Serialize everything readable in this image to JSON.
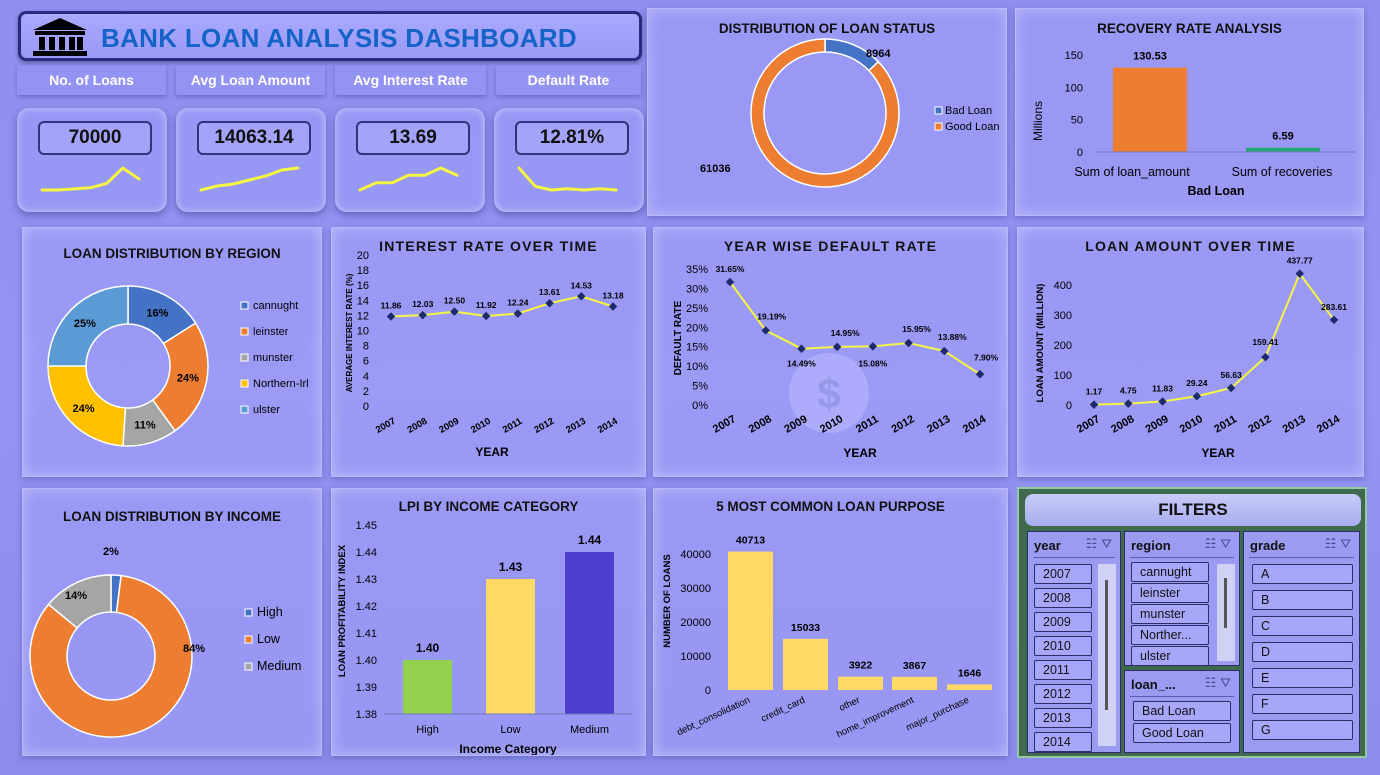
{
  "header": {
    "title": "BANK LOAN ANALYSIS DASHBOARD",
    "icon": "bank-icon"
  },
  "kpis": [
    {
      "label": "No. of Loans",
      "value": "70000",
      "trend": [
        10,
        10,
        11,
        12,
        16,
        30,
        20
      ]
    },
    {
      "label": "Avg Loan Amount",
      "value": "14063.14",
      "trend": [
        10,
        12,
        13,
        15,
        17,
        20,
        21
      ]
    },
    {
      "label": "Avg Interest Rate",
      "value": "13.69",
      "trend": [
        14,
        15,
        15,
        16,
        16,
        17,
        16
      ]
    },
    {
      "label": "Default Rate",
      "value": "12.81%",
      "trend": [
        30,
        15,
        12,
        13,
        12,
        13,
        12
      ]
    }
  ],
  "loan_status": {
    "title": "DISTRIBUTION OF LOAN STATUS",
    "legend": [
      "Bad Loan",
      "Good Loan"
    ],
    "values": [
      "8964",
      "61036"
    ],
    "colors": [
      "#4472c4",
      "#ed7d31"
    ]
  },
  "recovery": {
    "title": "RECOVERY RATE ANALYSIS",
    "categories": [
      "Sum of loan_amount",
      "Sum of recoveries"
    ],
    "values": [
      130.53,
      6.59
    ],
    "value_labels": [
      "130.53",
      "6.59"
    ],
    "ticks": [
      "150",
      "100",
      "50",
      "0"
    ],
    "ylabel": "Millions",
    "xlabel": "Bad Loan",
    "colors": [
      "#ed7d31",
      "#2aa874"
    ]
  },
  "region": {
    "title": "LOAN DISTRIBUTION BY REGION",
    "legend": [
      "cannught",
      "leinster",
      "munster",
      "Northern-Irl",
      "ulster"
    ],
    "values": [
      16,
      24,
      11,
      24,
      25
    ],
    "labels": [
      "16%",
      "24%",
      "11%",
      "24%",
      "25%"
    ],
    "colors": [
      "#4472c4",
      "#ed7d31",
      "#a5a5a5",
      "#ffc000",
      "#5b9bd5"
    ]
  },
  "interest": {
    "title": "INTEREST RATE OVER TIME",
    "years": [
      "2007",
      "2008",
      "2009",
      "2010",
      "2011",
      "2012",
      "2013",
      "2014"
    ],
    "values": [
      11.86,
      12.03,
      12.5,
      11.92,
      12.24,
      13.61,
      14.53,
      13.18
    ],
    "labels": [
      "11.86",
      "12.03",
      "12.50",
      "11.92",
      "12.24",
      "13.61",
      "14.53",
      "13.18"
    ],
    "ticks": [
      "20",
      "18",
      "16",
      "14",
      "12",
      "10",
      "8",
      "6",
      "4",
      "2",
      "0"
    ],
    "ylabel": "AVERAGE INTEREST RATE (%)",
    "xlabel": "YEAR"
  },
  "default_rate": {
    "title": "YEAR WISE DEFAULT RATE",
    "years": [
      "2007",
      "2008",
      "2009",
      "2010",
      "2011",
      "2012",
      "2013",
      "2014"
    ],
    "values": [
      31.65,
      19.19,
      14.49,
      14.95,
      15.08,
      15.95,
      13.88,
      7.9
    ],
    "labels": [
      "31.65%",
      "19.19%",
      "14.49%",
      "14.95%",
      "15.08%",
      "15.95%",
      "13.88%",
      "7.90%"
    ],
    "ticks": [
      "35%",
      "30%",
      "25%",
      "20%",
      "15%",
      "10%",
      "5%",
      "0%"
    ],
    "ylabel": "DEFAULT RATE",
    "xlabel": "YEAR"
  },
  "loan_amount": {
    "title": "LOAN AMOUNT OVER TIME",
    "years": [
      "2007",
      "2008",
      "2009",
      "2010",
      "2011",
      "2012",
      "2013",
      "2014"
    ],
    "values": [
      1.17,
      4.75,
      11.83,
      29.24,
      56.63,
      159.41,
      437.77,
      283.61
    ],
    "labels": [
      "1.17",
      "4.75",
      "11.83",
      "29.24",
      "56.63",
      "159.41",
      "437.77",
      "283.61"
    ],
    "ticks": [
      "400",
      "300",
      "200",
      "100",
      "0"
    ],
    "ylabel": "LOAN AMOUNT (MILLION)",
    "xlabel": "YEAR"
  },
  "income": {
    "title": "LOAN DISTRIBUTION BY INCOME",
    "legend": [
      "High",
      "Low",
      "Medium"
    ],
    "values": [
      2,
      84,
      14
    ],
    "labels": [
      "2%",
      "84%",
      "14%"
    ],
    "colors": [
      "#4472c4",
      "#ed7d31",
      "#a5a5a5"
    ]
  },
  "lpi": {
    "title": "LPI BY INCOME CATEGORY",
    "categories": [
      "High",
      "Low",
      "Medium"
    ],
    "values": [
      1.4,
      1.43,
      1.44
    ],
    "labels": [
      "1.40",
      "1.43",
      "1.44"
    ],
    "ticks": [
      "1.45",
      "1.44",
      "1.43",
      "1.42",
      "1.41",
      "1.40",
      "1.39",
      "1.38"
    ],
    "ylabel": "LOAN PROFITABILITY INDEX",
    "xlabel": "Income Category",
    "colors": [
      "#92d050",
      "#ffd966",
      "#4f3fcf"
    ]
  },
  "purpose": {
    "title": "5 MOST COMMON LOAN PURPOSE",
    "categories": [
      "debt_consolidation",
      "credit_card",
      "other",
      "home_improvement",
      "major_purchase"
    ],
    "values": [
      40713,
      15033,
      3922,
      3867,
      1646
    ],
    "labels": [
      "40713",
      "15033",
      "3922",
      "3867",
      "1646"
    ],
    "ticks": [
      "40000",
      "30000",
      "20000",
      "10000",
      "0"
    ],
    "ylabel": "NUMBER OF LOANS",
    "color": "#ffd966"
  },
  "filters": {
    "title": "FILTERS",
    "year": {
      "label": "year",
      "items": [
        "2007",
        "2008",
        "2009",
        "2010",
        "2011",
        "2012",
        "2013",
        "2014"
      ]
    },
    "region": {
      "label": "region",
      "items": [
        "cannught",
        "leinster",
        "munster",
        "Norther...",
        "ulster"
      ]
    },
    "loan": {
      "label": "loan_...",
      "items": [
        "Bad Loan",
        "Good Loan"
      ]
    },
    "grade": {
      "label": "grade",
      "items": [
        "A",
        "B",
        "C",
        "D",
        "E",
        "F",
        "G"
      ]
    }
  },
  "chart_data": [
    {
      "type": "pie",
      "title": "DISTRIBUTION OF LOAN STATUS",
      "categories": [
        "Bad Loan",
        "Good Loan"
      ],
      "values": [
        8964,
        61036
      ],
      "legend": "right"
    },
    {
      "type": "bar",
      "title": "RECOVERY RATE ANALYSIS",
      "categories": [
        "Sum of loan_amount",
        "Sum of recoveries"
      ],
      "values": [
        130.53,
        6.59
      ],
      "xlabel": "Bad Loan",
      "ylabel": "Millions",
      "ylim": [
        0,
        150
      ]
    },
    {
      "type": "pie",
      "title": "LOAN DISTRIBUTION BY REGION",
      "categories": [
        "cannught",
        "leinster",
        "munster",
        "Northern-Irl",
        "ulster"
      ],
      "values": [
        16,
        24,
        11,
        24,
        25
      ],
      "legend": "right"
    },
    {
      "type": "line",
      "title": "INTEREST RATE OVER TIME",
      "x": [
        2007,
        2008,
        2009,
        2010,
        2011,
        2012,
        2013,
        2014
      ],
      "values": [
        11.86,
        12.03,
        12.5,
        11.92,
        12.24,
        13.61,
        14.53,
        13.18
      ],
      "xlabel": "YEAR",
      "ylabel": "AVERAGE INTEREST RATE (%)",
      "ylim": [
        0,
        20
      ]
    },
    {
      "type": "line",
      "title": "YEAR WISE DEFAULT RATE",
      "x": [
        2007,
        2008,
        2009,
        2010,
        2011,
        2012,
        2013,
        2014
      ],
      "values": [
        31.65,
        19.19,
        14.49,
        14.95,
        15.08,
        15.95,
        13.88,
        7.9
      ],
      "xlabel": "YEAR",
      "ylabel": "DEFAULT RATE",
      "ylim": [
        0,
        35
      ]
    },
    {
      "type": "line",
      "title": "LOAN AMOUNT OVER TIME",
      "x": [
        2007,
        2008,
        2009,
        2010,
        2011,
        2012,
        2013,
        2014
      ],
      "values": [
        1.17,
        4.75,
        11.83,
        29.24,
        56.63,
        159.41,
        437.77,
        283.61
      ],
      "xlabel": "YEAR",
      "ylabel": "LOAN AMOUNT (MILLION)",
      "ylim": [
        0,
        450
      ]
    },
    {
      "type": "pie",
      "title": "LOAN DISTRIBUTION BY INCOME",
      "categories": [
        "High",
        "Low",
        "Medium"
      ],
      "values": [
        2,
        84,
        14
      ],
      "legend": "right"
    },
    {
      "type": "bar",
      "title": "LPI BY INCOME CATEGORY",
      "categories": [
        "High",
        "Low",
        "Medium"
      ],
      "values": [
        1.4,
        1.43,
        1.44
      ],
      "xlabel": "Income Category",
      "ylabel": "LOAN PROFITABILITY INDEX",
      "ylim": [
        1.38,
        1.45
      ]
    },
    {
      "type": "bar",
      "title": "5 MOST COMMON LOAN PURPOSE",
      "categories": [
        "debt_consolidation",
        "credit_card",
        "other",
        "home_improvement",
        "major_purchase"
      ],
      "values": [
        40713,
        15033,
        3922,
        3867,
        1646
      ],
      "ylabel": "NUMBER OF LOANS",
      "ylim": [
        0,
        45000
      ]
    }
  ]
}
